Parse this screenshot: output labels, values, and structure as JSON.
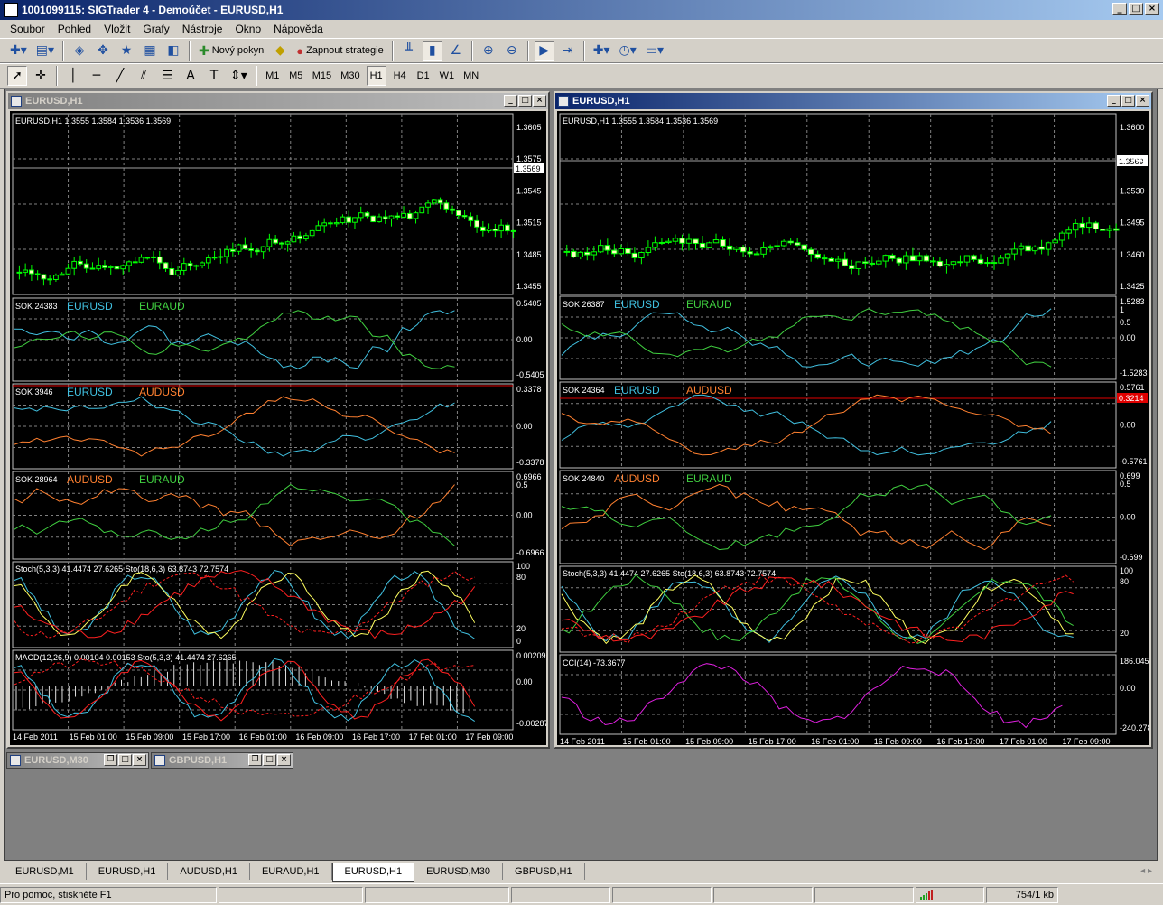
{
  "window": {
    "title": "1001099115: SIGTrader 4 - Demoúčet - EURUSD,H1"
  },
  "menu": [
    "Soubor",
    "Pohled",
    "Vložit",
    "Grafy",
    "Nástroje",
    "Okno",
    "Nápověda"
  ],
  "toolbar": {
    "new_order": "Nový pokyn",
    "start_strategy": "Zapnout strategie"
  },
  "timeframes": [
    "M1",
    "M5",
    "M15",
    "M30",
    "H1",
    "H4",
    "D1",
    "W1",
    "MN"
  ],
  "active_timeframe": "H1",
  "left_chart": {
    "title": "EURUSD,H1",
    "header": "EURUSD,H1  1.3555 1.3584 1.3536 1.3569",
    "price_axis": [
      "1.3605",
      "1.3575",
      "1.3545",
      "1.3515",
      "1.3485",
      "1.3455"
    ],
    "current_price": "1.3569",
    "sok1": {
      "label": "SOK 24383",
      "s1": "EURUSD",
      "s2": "EURAUD",
      "top": "0.5405",
      "mid": "0.00",
      "bot": "-0.5405"
    },
    "sok2": {
      "label": "SOK 3946",
      "s1": "EURUSD",
      "s2": "AUDUSD",
      "top": "0.3378",
      "mid": "0.00",
      "bot": "-0.3378"
    },
    "sok3": {
      "label": "SOK 28964",
      "s1": "AUDUSD",
      "s2": "EURAUD",
      "top": "0.6966",
      "top2": "0.5",
      "mid": "0.00",
      "bot": "-0.6966"
    },
    "stoch": {
      "label": "Stoch(5,3,3) 41.4474 27.6265   Sto(18,6,3) 63.8743 72.7574",
      "l100": "100",
      "l80": "80",
      "l20": "20",
      "l0": "0"
    },
    "macd": {
      "label": "MACD(12,26,9) 0.00104 0.00153   Sto(5,3,3) 41.4474 27.6265",
      "top": "0.00209",
      "mid": "0.00",
      "bot": "-0.00287"
    },
    "time_axis": [
      "14 Feb 2011",
      "15 Feb 01:00",
      "15 Feb 09:00",
      "15 Feb 17:00",
      "16 Feb 01:00",
      "16 Feb 09:00",
      "16 Feb 17:00",
      "17 Feb 01:00",
      "17 Feb 09:00"
    ]
  },
  "right_chart": {
    "title": "EURUSD,H1",
    "header": "EURUSD,H1  1.3555 1.3584 1.3536 1.3569",
    "price_axis": [
      "1.3600",
      "1.3565",
      "1.3530",
      "1.3495",
      "1.3460",
      "1.3425"
    ],
    "current_price": "1.3569",
    "sok1": {
      "label": "SOK 26387",
      "s1": "EURUSD",
      "s2": "EURAUD",
      "top": "1.5283",
      "t1": "1",
      "t05": "0.5",
      "mid": "0.00",
      "bot": "-1.5283"
    },
    "sok2": {
      "label": "SOK 24364",
      "s1": "EURUSD",
      "s2": "AUDUSD",
      "top": "0.5761",
      "red": "0.3214",
      "mid": "0.00",
      "bot": "-0.5761"
    },
    "sok3": {
      "label": "SOK 24840",
      "s1": "AUDUSD",
      "s2": "EURAUD",
      "top": "0.699",
      "top2": "0.5",
      "mid": "0.00",
      "bot": "-0.699"
    },
    "stoch": {
      "label": "Stoch(5,3,3) 41.4474 27.6265   Sto(18,6,3) 63.8743 72.7574",
      "l100": "100",
      "l80": "80",
      "l20": "20"
    },
    "cci": {
      "label": "CCI(14) -73.3677",
      "top": "186.045",
      "mid": "0.00",
      "bot": "-240.278"
    },
    "time_axis": [
      "14 Feb 2011",
      "15 Feb 01:00",
      "15 Feb 09:00",
      "15 Feb 17:00",
      "16 Feb 01:00",
      "16 Feb 09:00",
      "16 Feb 17:00",
      "17 Feb 01:00",
      "17 Feb 09:00"
    ]
  },
  "minimized": [
    "EURUSD,M30",
    "GBPUSD,H1"
  ],
  "tabs": [
    "EURUSD,M1",
    "EURUSD,H1",
    "AUDUSD,H1",
    "EURAUD,H1",
    "EURUSD,H1",
    "EURUSD,M30",
    "GBPUSD,H1"
  ],
  "active_tab": 4,
  "status": {
    "help": "Pro pomoc, stiskněte F1",
    "traffic": "754/1 kb"
  },
  "colors": {
    "candle": "#00ff00",
    "eurusd": "#40c0e0",
    "euraud": "#40d040",
    "audusd": "#ff8030",
    "stoch_main": "#40c0e0",
    "stoch_sig": "#ffff60",
    "sto2": "#ff2020",
    "cci": "#e020e0",
    "bg": "#000000",
    "grid": "#808080"
  }
}
